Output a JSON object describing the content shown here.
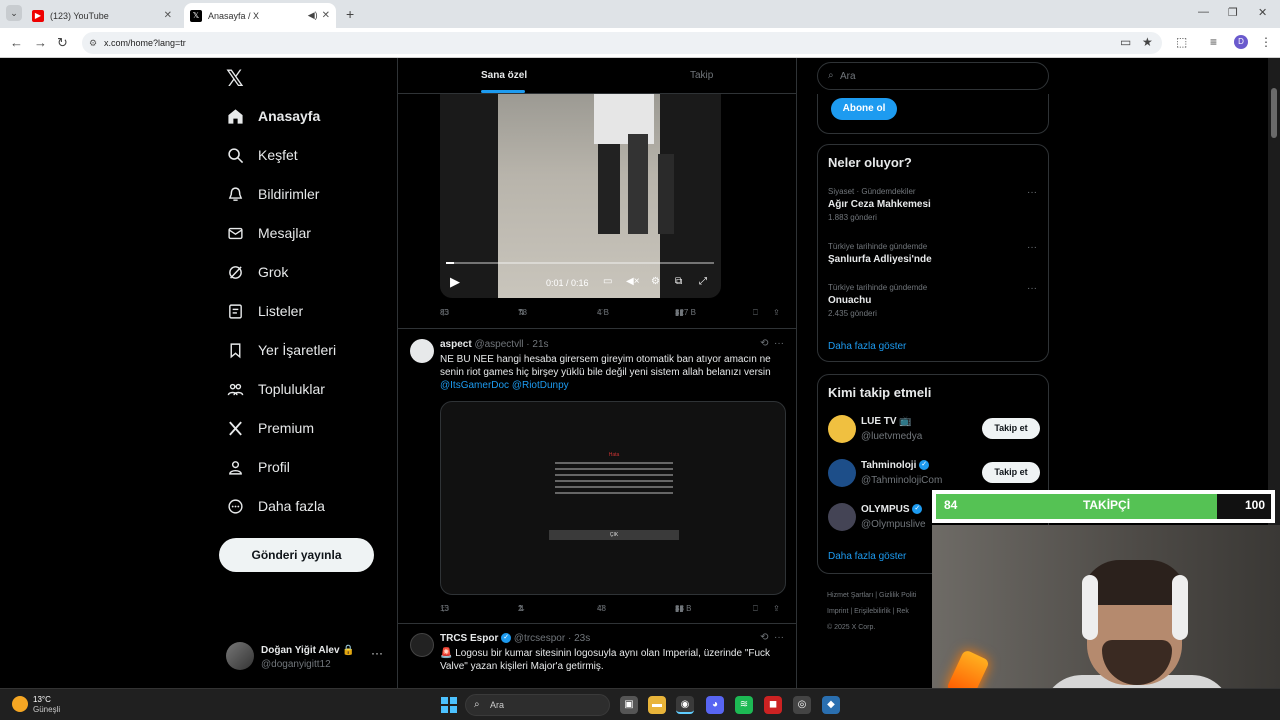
{
  "browser": {
    "tabs": [
      {
        "title": "(123) YouTube",
        "close": "✕"
      },
      {
        "title": "Anasayfa / X",
        "close": "✕"
      }
    ],
    "new_tab": "+",
    "url": "x.com/home?lang=tr"
  },
  "sidebar": {
    "logo": "𝕏",
    "items": [
      {
        "label": "Anasayfa",
        "icon": "home-icon"
      },
      {
        "label": "Keşfet",
        "icon": "search-icon"
      },
      {
        "label": "Bildirimler",
        "icon": "bell-icon"
      },
      {
        "label": "Mesajlar",
        "icon": "mail-icon"
      },
      {
        "label": "Grok",
        "icon": "grok-icon"
      },
      {
        "label": "Listeler",
        "icon": "list-icon"
      },
      {
        "label": "Yer İşaretleri",
        "icon": "bookmark-icon"
      },
      {
        "label": "Topluluklar",
        "icon": "communities-icon"
      },
      {
        "label": "Premium",
        "icon": "x-icon"
      },
      {
        "label": "Profil",
        "icon": "person-icon"
      },
      {
        "label": "Daha fazla",
        "icon": "more-circle-icon"
      }
    ],
    "post_button": "Gönderi yayınla",
    "account": {
      "name": "Doğan Yiğit Alev 🔒",
      "handle": "@doganyigitt12",
      "menu": "···"
    }
  },
  "timeline": {
    "tabs": [
      "Sana özel",
      "Takip"
    ],
    "video": {
      "time": "0:01 / 0:16",
      "progress_fraction": 0.03
    },
    "post1_actions": {
      "replies": "83",
      "reposts": "78",
      "likes": "4 B",
      "views": "327 B"
    },
    "post2": {
      "name": "aspect",
      "handle": "@aspectvll · 21s",
      "text": "NE BU NEE hangi hesaba girersem gireyim otomatik ban atıyor amacın ne senin riot games hiç birşey yüklü bile değil yeni sistem allah belanızı versin",
      "mentions": "@ItsGamerDoc @RiotDunpy",
      "dialog_title": "Hata",
      "dialog_button": "ÇIK",
      "actions": {
        "replies": "13",
        "reposts": "2",
        "likes": "48",
        "views": "38 B"
      }
    },
    "post3": {
      "name": "TRCS Espor",
      "handle": "@trcsespor · 23s",
      "text": "🚨 Logosu bir kumar sitesinin logosuyla aynı olan Imperial, üzerinde \"Fuck Valve\" yazan kişileri Major'a getirmiş."
    }
  },
  "right": {
    "search_placeholder": "Ara",
    "subscribe_button": "Abone ol",
    "trends_title": "Neler oluyor?",
    "trends": [
      {
        "category": "Siyaset · Gündemdekiler",
        "title": "Ağır Ceza Mahkemesi",
        "count": "1.883 gönderi"
      },
      {
        "category": "Türkiye tarihinde gündemde",
        "title": "Şanlıurfa Adliyesi'nde",
        "count": ""
      },
      {
        "category": "Türkiye tarihinde gündemde",
        "title": "Onuachu",
        "count": "2.435 gönderi"
      }
    ],
    "show_more": "Daha fazla göster",
    "who_title": "Kimi takip etmeli",
    "who": [
      {
        "name": "LUE TV 📺",
        "handle": "@luetvmedya",
        "button": "Takip et"
      },
      {
        "name": "Tahminoloji",
        "handle": "@TahminolojiCom",
        "button": "Takip et"
      },
      {
        "name": "OLYMPUS",
        "handle": "@Olympuslive",
        "button": ""
      }
    ],
    "footer": [
      "Hizmet Şartları  |  Gizlilik Politi",
      "Imprint  |  Erişilebilirlik  |  Rek",
      "© 2025 X Corp."
    ]
  },
  "overlay": {
    "current": "84",
    "label": "TAKİPÇİ",
    "goal": "100",
    "fill_fraction": 0.84
  },
  "taskbar": {
    "temp": "13°C",
    "condition": "Güneşli",
    "search": "Ara"
  }
}
